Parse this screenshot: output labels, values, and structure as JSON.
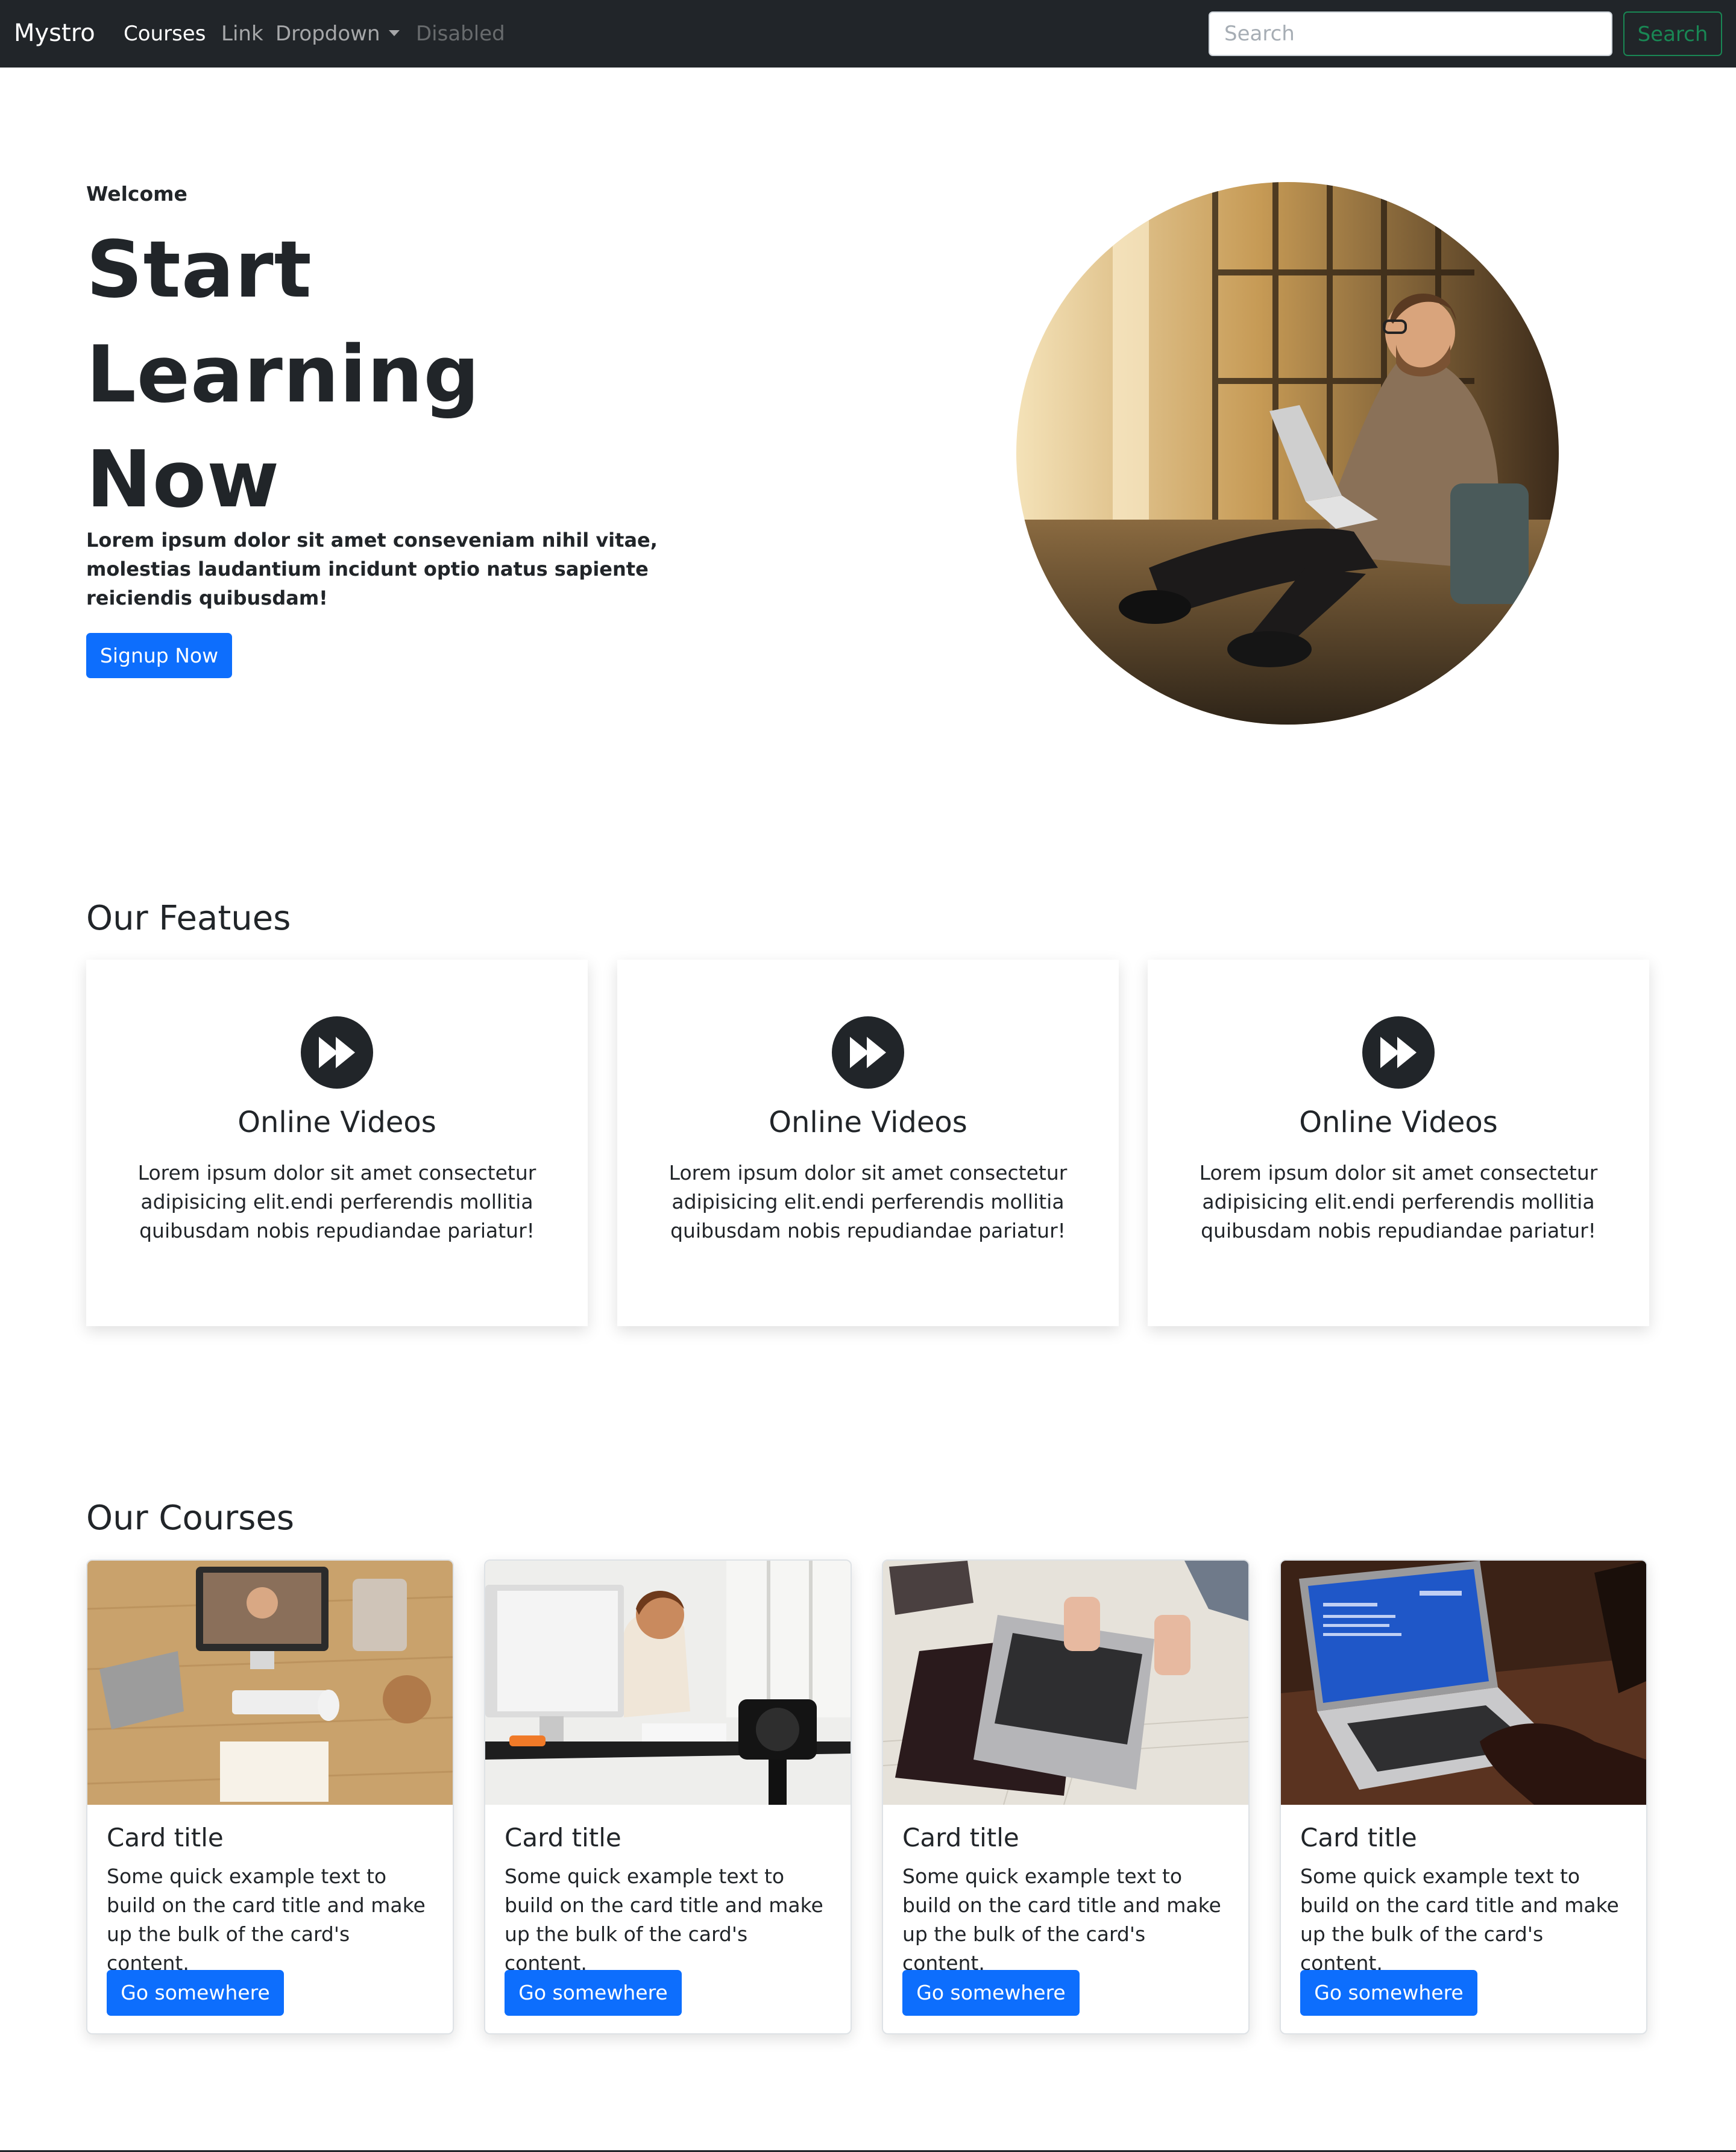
{
  "navbar": {
    "brand": "Mystro",
    "links": [
      {
        "label": "Courses",
        "state": "active"
      },
      {
        "label": "Link",
        "state": "normal"
      },
      {
        "label": "Dropdown",
        "state": "dropdown"
      },
      {
        "label": "Disabled",
        "state": "disabled"
      }
    ],
    "search_placeholder": "Search",
    "search_button": "Search"
  },
  "hero": {
    "eyebrow": "Welcome",
    "title_lines": [
      "Start",
      "Learning",
      "Now"
    ],
    "text": "Lorem ipsum dolor sit amet conseveniam nihil vitae, molestias laudantium incidunt optio natus sapiente reiciendis quibusdam!",
    "button": "Signup Now"
  },
  "features": {
    "heading": "Our Featues",
    "items": [
      {
        "icon": "fast-forward-icon",
        "title": "Online Videos",
        "text": "Lorem ipsum dolor sit amet consectetur adipisicing elit.endi perferendis mollitia quibusdam nobis repudiandae pariatur!"
      },
      {
        "icon": "fast-forward-icon",
        "title": "Online Videos",
        "text": "Lorem ipsum dolor sit amet consectetur adipisicing elit.endi perferendis mollitia quibusdam nobis repudiandae pariatur!"
      },
      {
        "icon": "fast-forward-icon",
        "title": "Online Videos",
        "text": "Lorem ipsum dolor sit amet consectetur adipisicing elit.endi perferendis mollitia quibusdam nobis repudiandae pariatur!"
      }
    ]
  },
  "courses": {
    "heading": "Our Courses",
    "cards": [
      {
        "title": "Card title",
        "text": "Some quick example text to build on the card title and make up the bulk of the card's content.",
        "button": "Go somewhere"
      },
      {
        "title": "Card title",
        "text": "Some quick example text to build on the card title and make up the bulk of the card's content.",
        "button": "Go somewhere"
      },
      {
        "title": "Card title",
        "text": "Some quick example text to build on the card title and make up the bulk of the card's content.",
        "button": "Go somewhere"
      },
      {
        "title": "Card title",
        "text": "Some quick example text to build on the card title and make up the bulk of the card's content.",
        "button": "Go somewhere"
      }
    ]
  },
  "colors": {
    "navbar_bg": "#212529",
    "primary": "#0d6efd",
    "success": "#198754",
    "text": "#212529"
  }
}
